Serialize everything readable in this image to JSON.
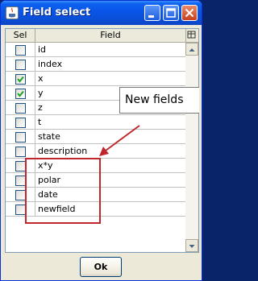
{
  "window": {
    "title": "Field select"
  },
  "table": {
    "columns": [
      "Sel",
      "Field"
    ],
    "rows": [
      {
        "field": "id",
        "selected": false
      },
      {
        "field": "index",
        "selected": false
      },
      {
        "field": "x",
        "selected": true
      },
      {
        "field": "y",
        "selected": true
      },
      {
        "field": "z",
        "selected": false
      },
      {
        "field": "t",
        "selected": false
      },
      {
        "field": "state",
        "selected": false
      },
      {
        "field": "description",
        "selected": false
      },
      {
        "field": "x*y",
        "selected": false
      },
      {
        "field": "polar",
        "selected": false
      },
      {
        "field": "date",
        "selected": false
      },
      {
        "field": "newfield",
        "selected": false
      }
    ]
  },
  "annotation": {
    "text": "New fields",
    "color": "#c0272d"
  },
  "footer": {
    "ok_label": "Ok"
  }
}
